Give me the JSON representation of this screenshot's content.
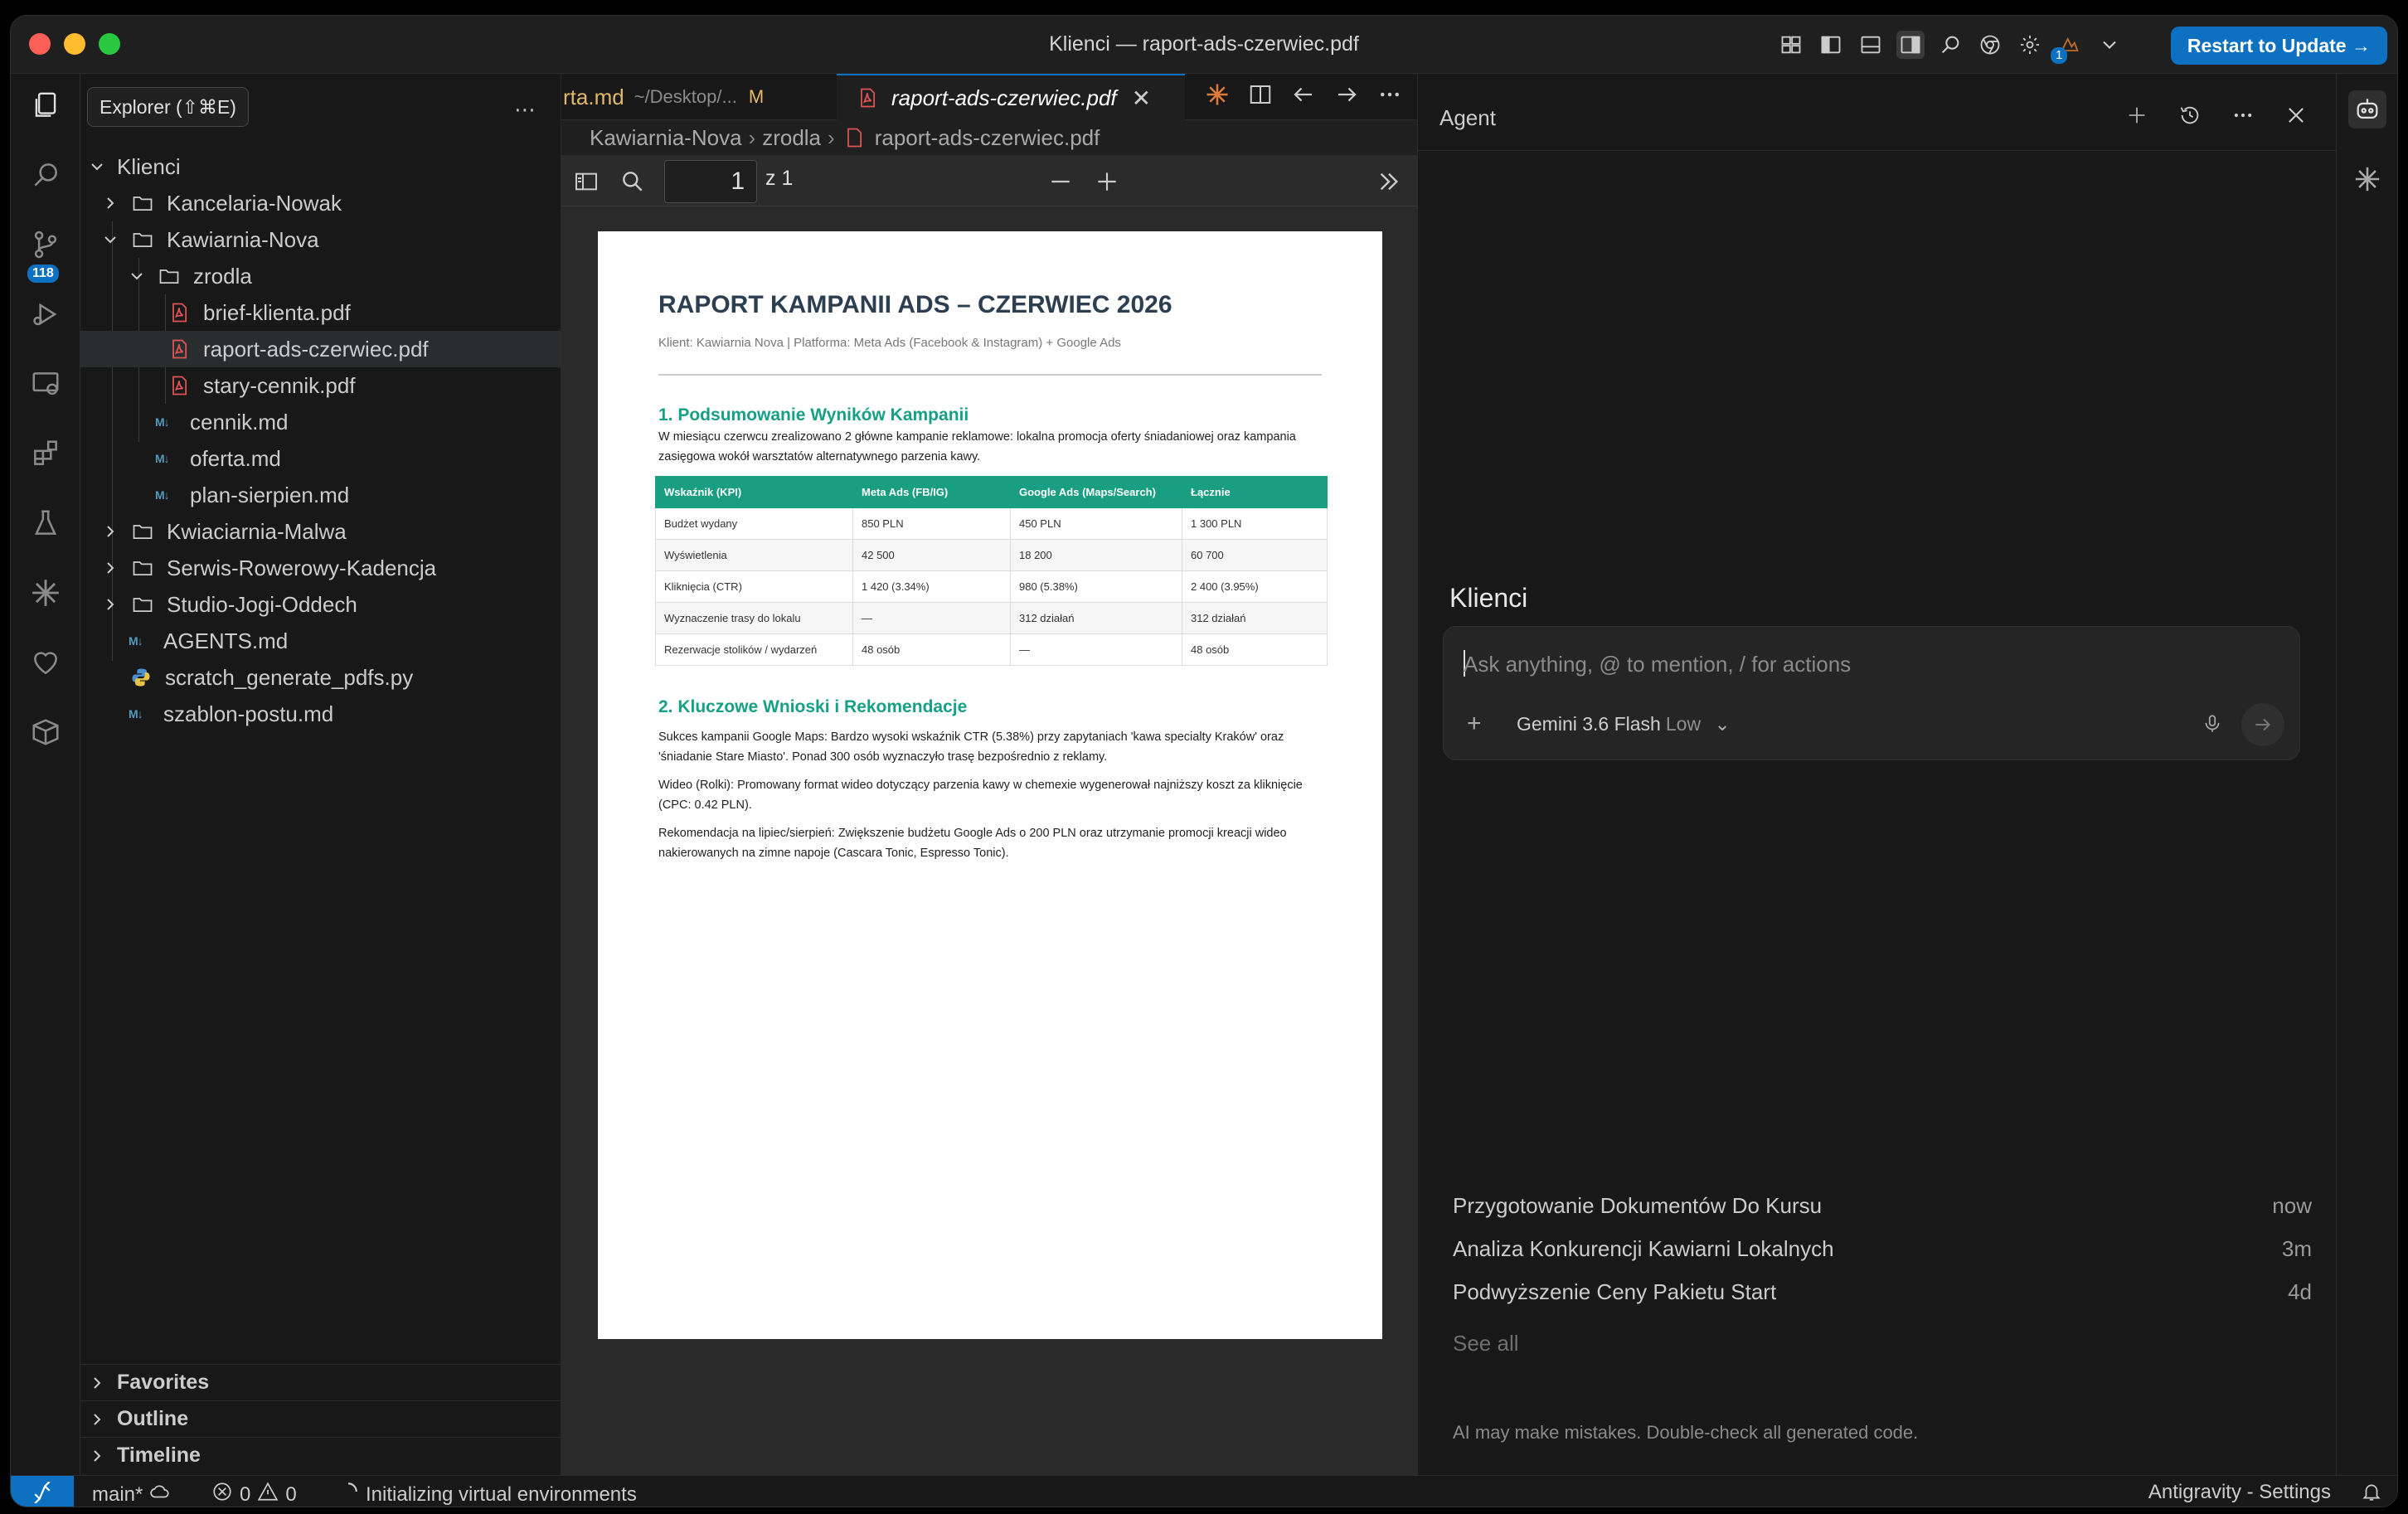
{
  "window": {
    "title": "Klienci — raport-ads-czerwiec.pdf"
  },
  "titlebar": {
    "update_label": "Restart to Update →",
    "notification_count": "1"
  },
  "activity": {
    "tooltip": "Explorer (⇧⌘E)",
    "scm_badge": "118"
  },
  "explorer": {
    "root": "Klienci",
    "items": [
      {
        "label": "Kancelaria-Nowak"
      },
      {
        "label": "Kawiarnia-Nova"
      },
      {
        "label": "zrodla"
      },
      {
        "label": "brief-klienta.pdf"
      },
      {
        "label": "raport-ads-czerwiec.pdf"
      },
      {
        "label": "stary-cennik.pdf"
      },
      {
        "label": "cennik.md"
      },
      {
        "label": "oferta.md"
      },
      {
        "label": "plan-sierpien.md"
      },
      {
        "label": "Kwiaciarnia-Malwa"
      },
      {
        "label": "Serwis-Rowerowy-Kadencja"
      },
      {
        "label": "Studio-Jogi-Oddech"
      },
      {
        "label": "AGENTS.md"
      },
      {
        "label": "scratch_generate_pdfs.py"
      },
      {
        "label": "szablon-postu.md"
      }
    ],
    "md_icon": "M↓",
    "sections": {
      "favorites": "Favorites",
      "outline": "Outline",
      "timeline": "Timeline"
    }
  },
  "editor": {
    "tabs": [
      {
        "label": "rta.md",
        "path": "~/Desktop/...",
        "status": "M"
      },
      {
        "label": "raport-ads-czerwiec.pdf"
      }
    ],
    "breadcrumb": [
      "Kawiarnia-Nova",
      "zrodla",
      "raport-ads-czerwiec.pdf"
    ],
    "pdf": {
      "page": "1",
      "page_of": "z 1"
    }
  },
  "document": {
    "title": "RAPORT KAMPANII ADS – CZERWIEC 2026",
    "subtitle": "Klient: Kawiarnia Nova | Platforma: Meta Ads (Facebook & Instagram) + Google Ads",
    "section1": {
      "heading": "1. Podsumowanie Wyników Kampanii",
      "para": "W miesiącu czerwcu zrealizowano 2 główne kampanie reklamowe: lokalna promocja oferty śniadaniowej oraz kampania zasięgowa wokół warsztatów alternatywnego parzenia kawy."
    },
    "table": {
      "headers": [
        "Wskaźnik (KPI)",
        "Meta Ads (FB/IG)",
        "Google Ads (Maps/Search)",
        "Łącznie"
      ],
      "rows": [
        [
          "Budżet wydany",
          "850 PLN",
          "450 PLN",
          "1 300 PLN"
        ],
        [
          "Wyświetlenia",
          "42 500",
          "18 200",
          "60 700"
        ],
        [
          "Kliknięcia (CTR)",
          "1 420 (3.34%)",
          "980 (5.38%)",
          "2 400 (3.95%)"
        ],
        [
          "Wyznaczenie trasy do lokalu",
          "—",
          "312 działań",
          "312 działań"
        ],
        [
          "Rezerwacje stolików / wydarzeń",
          "48 osób",
          "—",
          "48 osób"
        ]
      ]
    },
    "section2": {
      "heading": "2. Kluczowe Wnioski i Rekomendacje",
      "p1": "Sukces kampanii Google Maps: Bardzo wysoki wskaźnik CTR (5.38%) przy zapytaniach 'kawa specialty Kraków' oraz 'śniadanie Stare Miasto'. Ponad 300 osób wyznaczyło trasę bezpośrednio z reklamy.",
      "p2": "Wideo (Rolki): Promowany format wideo dotyczący parzenia kawy w chemexie wygenerował najniższy koszt za kliknięcie (CPC: 0.42 PLN).",
      "p3": "Rekomendacja na lipiec/sierpień: Zwiększenie budżetu Google Ads o 200 PLN oraz utrzymanie promocji kreacji wideo nakierowanych na zimne napoje (Cascara Tonic, Espresso Tonic)."
    }
  },
  "agent": {
    "title": "Agent",
    "heading": "Klienci",
    "input_placeholder": "Ask anything, @ to mention, / for actions",
    "model": "Gemini 3.6 Flash",
    "mode": "Low",
    "history": [
      {
        "title": "Przygotowanie Dokumentów Do Kursu",
        "time": "now"
      },
      {
        "title": "Analiza Konkurencji Kawiarni Lokalnych",
        "time": "3m"
      },
      {
        "title": "Podwyższenie Ceny Pakietu Start",
        "time": "4d"
      }
    ],
    "see_all": "See all",
    "disclaimer": "AI may make mistakes. Double-check all generated code."
  },
  "status": {
    "branch": "main*",
    "errors": "0",
    "warnings": "0",
    "task": "Initializing virtual environments",
    "settings": "Antigravity - Settings"
  },
  "colors": {
    "accent": "#0e70c0",
    "pdf_heading": "#16a085",
    "table_header": "#1a9e81"
  }
}
